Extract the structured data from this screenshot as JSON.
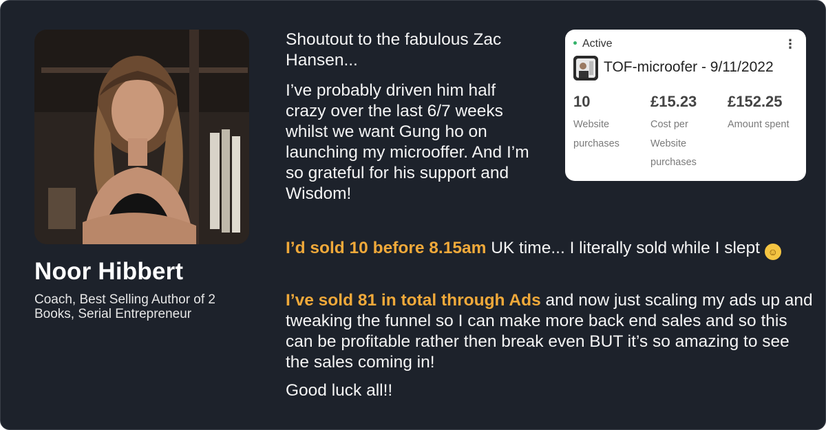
{
  "person": {
    "name": "Noor Hibbert",
    "role": "Coach, Best Selling Author of 2 Books, Serial Entrepreneur"
  },
  "testimonial": {
    "intro": "Shoutout to the fabulous Zac Hansen...",
    "body": "I’ve probably driven him half crazy over the last 6/7 weeks whilst we want Gung ho on launching my microoffer. And I’m so grateful for his support and Wisdom!",
    "highlight_1": "I’d sold 10 before 8.15am",
    "text_1": " UK time... I literally sold while I slept ",
    "highlight_2": "I’ve sold 81 in total through Ads",
    "text_2": " and now just scaling my ads up and tweaking the funnel so I can make more back end sales and so this can be profitable rather then break even BUT it’s so amazing to see the sales coming in!",
    "closing": "Good luck all!!"
  },
  "ad_card": {
    "status": "Active",
    "campaign": "TOF-microofer - 9/11/2022",
    "metrics": [
      {
        "value": "10",
        "label": "Website purchases"
      },
      {
        "value": "£15.23",
        "label": "Cost per Website purchases"
      },
      {
        "value": "£152.25",
        "label": "Amount spent"
      }
    ],
    "menu_icon": "kebab-menu-icon"
  },
  "colors": {
    "background": "#1d222b",
    "highlight": "#f0a93a",
    "text": "#f4f4f4",
    "status_green": "#34b36a"
  },
  "icons": {
    "emoji": "laughing-tears-emoji"
  }
}
